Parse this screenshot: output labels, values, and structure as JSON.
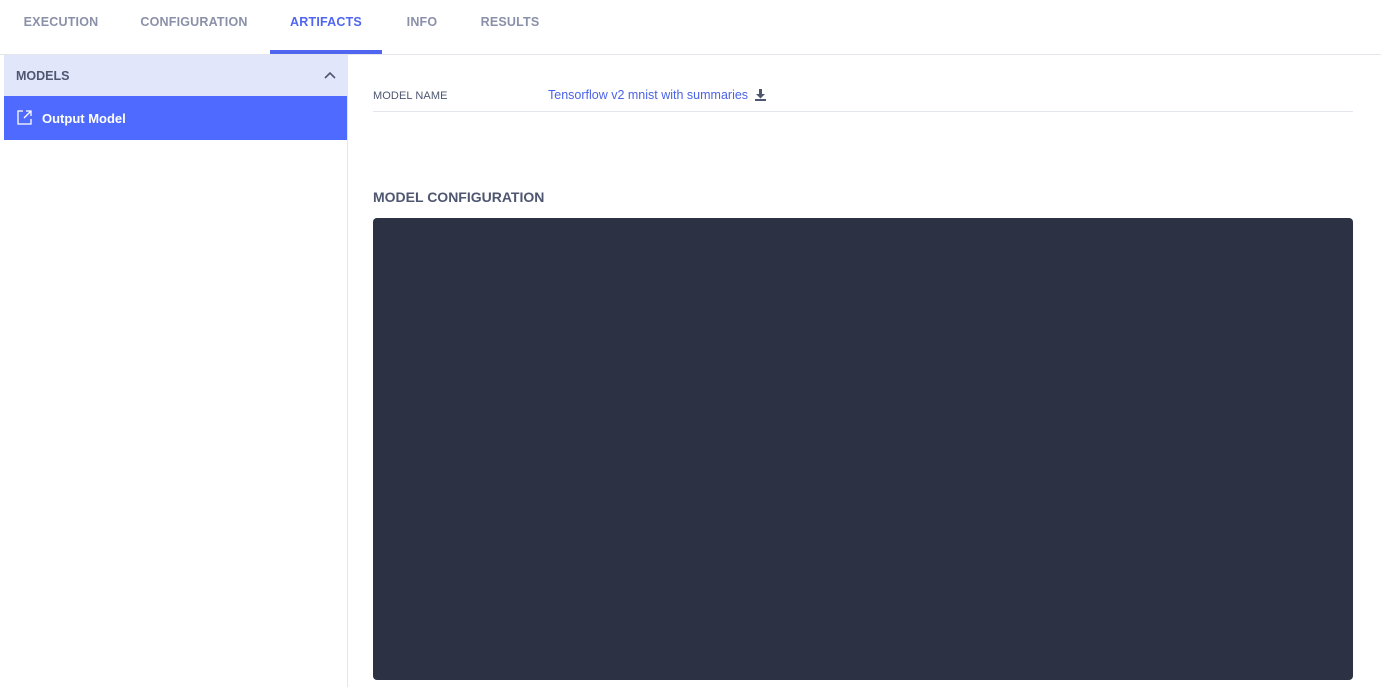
{
  "tabs": [
    {
      "label": "EXECUTION"
    },
    {
      "label": "CONFIGURATION"
    },
    {
      "label": "ARTIFACTS",
      "active": true
    },
    {
      "label": "INFO"
    },
    {
      "label": "RESULTS"
    }
  ],
  "sidebar": {
    "section_title": "MODELS",
    "items": [
      {
        "label": "Output Model",
        "icon": "external-link-icon"
      }
    ]
  },
  "main": {
    "model_name_label": "MODEL NAME",
    "model_name_value": "Tensorflow v2 mnist with summaries",
    "config_title": "MODEL CONFIGURATION",
    "config_content": ""
  },
  "colors": {
    "accent": "#5066f0",
    "selected_item_bg": "#4f6bff",
    "section_header_bg": "#e2e6fb",
    "code_panel_bg": "#2c3144",
    "muted_text": "#8a90a8"
  }
}
